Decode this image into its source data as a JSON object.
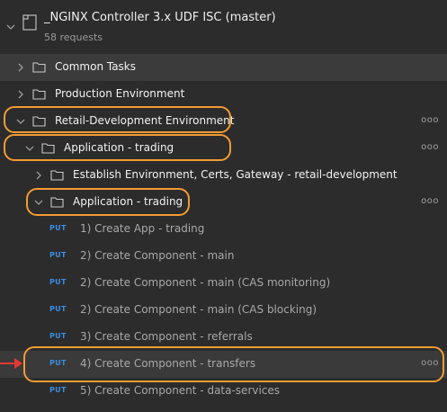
{
  "collection": {
    "title": "_NGINX Controller 3.x UDF ISC (master)",
    "request_count": "58 requests"
  },
  "tree": {
    "common_tasks": "Common Tasks",
    "production_env": "Production Environment",
    "retail_dev_env": "Retail-Development Environment",
    "app_trading_1": "Application - trading",
    "establish_env": "Establish Environment, Certs, Gateway - retail-development",
    "app_trading_2": "Application - trading"
  },
  "requests": [
    {
      "method": "PUT",
      "name": "1) Create App - trading"
    },
    {
      "method": "PUT",
      "name": "2) Create Component - main"
    },
    {
      "method": "PUT",
      "name": "2) Create Component - main (CAS monitoring)"
    },
    {
      "method": "PUT",
      "name": "2) Create Component - main (CAS blocking)"
    },
    {
      "method": "PUT",
      "name": "3) Create Component - referrals"
    },
    {
      "method": "PUT",
      "name": "4) Create Component - transfers"
    },
    {
      "method": "PUT",
      "name": "5) Create Component - data-services"
    }
  ],
  "more_label": "ooo",
  "colors": {
    "background": "#2c2c2c",
    "highlight": "#f39c34",
    "method_put": "#3a8de0",
    "arrow": "#e53935"
  }
}
